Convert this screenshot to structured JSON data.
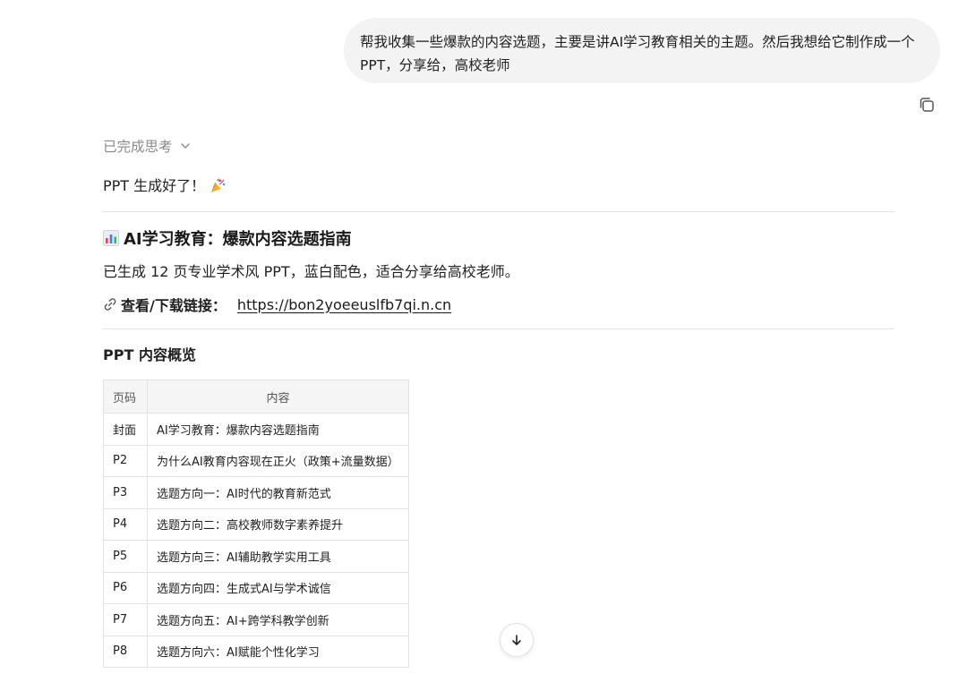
{
  "user_message": "帮我收集一些爆款的内容选题，主要是讲AI学习教育相关的主题。然后我想给它制作成一个PPT，分享给，高校老师",
  "thinking_status": "已完成思考",
  "done_message": "PPT 生成好了！",
  "guide": {
    "icon": "bar-chart-icon",
    "title": "AI学习教育：爆款内容选题指南",
    "summary": "已生成 12 页专业学术风 PPT，蓝白配色，适合分享给高校老师。",
    "link_icon": "link-icon",
    "link_label": "查看/下载链接：",
    "link_url": "https://bon2yoeeuslfb7qi.n.cn"
  },
  "overview": {
    "title": "PPT 内容概览",
    "headers": [
      "页码",
      "内容"
    ],
    "rows": [
      {
        "page": "封面",
        "content": "AI学习教育：爆款内容选题指南"
      },
      {
        "page": "P2",
        "content": "为什么AI教育内容现在正火（政策+流量数据）"
      },
      {
        "page": "P3",
        "content": "选题方向一：AI时代的教育新范式"
      },
      {
        "page": "P4",
        "content": "选题方向二：高校教师数字素养提升"
      },
      {
        "page": "P5",
        "content": "选题方向三：AI辅助教学实用工具"
      },
      {
        "page": "P6",
        "content": "选题方向四：生成式AI与学术诚信"
      },
      {
        "page": "P7",
        "content": "选题方向五：AI+跨学科教学创新"
      },
      {
        "page": "P8",
        "content": "选题方向六：AI赋能个性化学习"
      }
    ]
  },
  "icons": {
    "copy": "copy-icon",
    "chevron": "chevron-down-icon",
    "party": "party-popper-icon",
    "scroll": "arrow-down-icon"
  }
}
